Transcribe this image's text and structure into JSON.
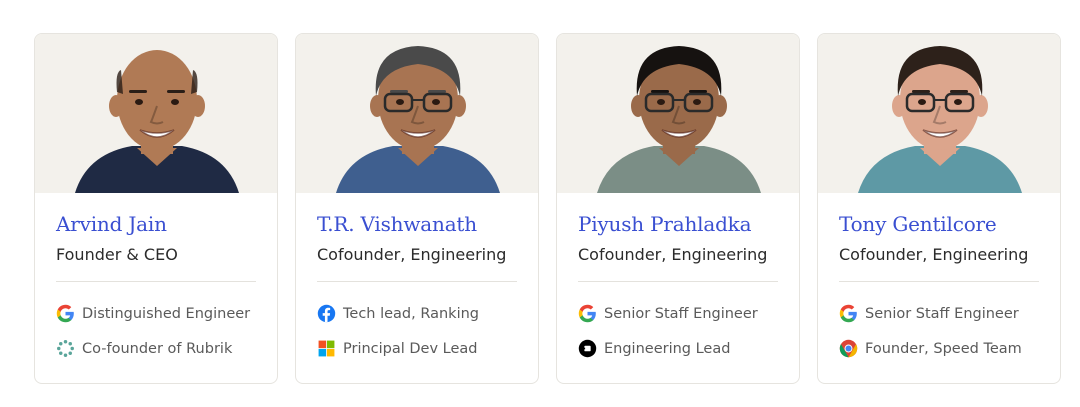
{
  "people": [
    {
      "name": "Arvind Jain",
      "role": "Founder & CEO",
      "credentials": [
        {
          "icon": "google-icon",
          "text": "Distinguished Engineer"
        },
        {
          "icon": "rubrik-icon",
          "text": "Co-founder of Rubrik"
        }
      ],
      "photo": {
        "skin": "#b07a55",
        "hair": "#2a1e17",
        "shirt": "#1f2a44",
        "glasses": false,
        "bald": true
      }
    },
    {
      "name": "T.R. Vishwanath",
      "role": "Cofounder, Engineering",
      "credentials": [
        {
          "icon": "facebook-icon",
          "text": "Tech lead, Ranking"
        },
        {
          "icon": "microsoft-icon",
          "text": "Principal Dev Lead"
        }
      ],
      "photo": {
        "skin": "#a87452",
        "hair": "#4a4a4a",
        "shirt": "#3f5f8f",
        "glasses": true,
        "bald": false
      }
    },
    {
      "name": "Piyush Prahladka",
      "role": "Cofounder, Engineering",
      "credentials": [
        {
          "icon": "google-icon",
          "text": "Senior Staff Engineer"
        },
        {
          "icon": "uber-icon",
          "text": "Engineering Lead"
        }
      ],
      "photo": {
        "skin": "#9a6a4a",
        "hair": "#161210",
        "shirt": "#7b8e86",
        "glasses": true,
        "bald": false
      }
    },
    {
      "name": "Tony Gentilcore",
      "role": "Cofounder, Engineering",
      "credentials": [
        {
          "icon": "google-icon",
          "text": "Senior Staff Engineer"
        },
        {
          "icon": "chrome-icon",
          "text": "Founder, Speed Team"
        }
      ],
      "photo": {
        "skin": "#dca58c",
        "hair": "#2d211a",
        "shirt": "#5e99a5",
        "glasses": true,
        "bald": false
      }
    }
  ],
  "colors": {
    "name": "#3a4fd1",
    "photo_bg": "#f3f1ec",
    "border": "#e6e4df"
  }
}
